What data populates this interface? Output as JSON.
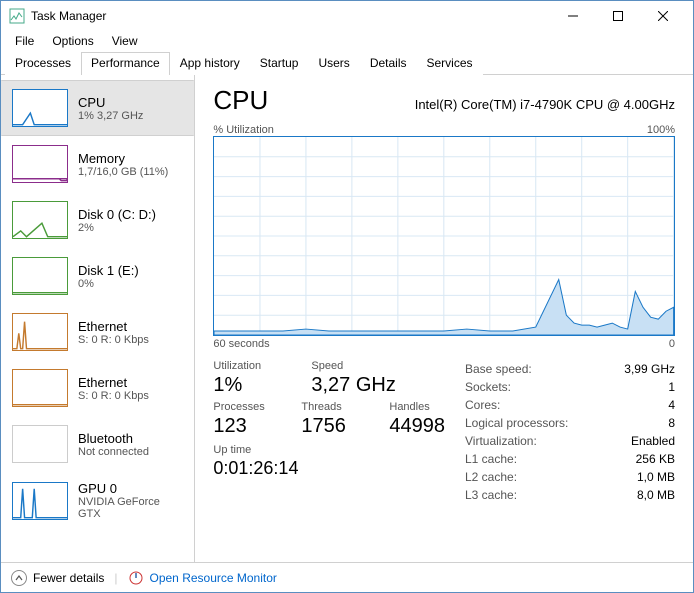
{
  "window": {
    "title": "Task Manager"
  },
  "menu": {
    "file": "File",
    "options": "Options",
    "view": "View"
  },
  "tabs": {
    "processes": "Processes",
    "performance": "Performance",
    "app_history": "App history",
    "startup": "Startup",
    "users": "Users",
    "details": "Details",
    "services": "Services"
  },
  "sidebar": [
    {
      "name": "CPU",
      "sub": "1% 3,27 GHz",
      "color": "#1a78c7"
    },
    {
      "name": "Memory",
      "sub": "1,7/16,0 GB (11%)",
      "color": "#8b2d8b"
    },
    {
      "name": "Disk 0 (C: D:)",
      "sub": "2%",
      "color": "#4a9b3a"
    },
    {
      "name": "Disk 1 (E:)",
      "sub": "0%",
      "color": "#4a9b3a"
    },
    {
      "name": "Ethernet",
      "sub": "S: 0  R: 0 Kbps",
      "color": "#c47a2e"
    },
    {
      "name": "Ethernet",
      "sub": "S: 0  R: 0 Kbps",
      "color": "#c47a2e"
    },
    {
      "name": "Bluetooth",
      "sub": "Not connected",
      "color": "#aaa"
    },
    {
      "name": "GPU 0",
      "sub": "NVIDIA GeForce GTX",
      "color": "#1a78c7"
    }
  ],
  "detail": {
    "title": "CPU",
    "model": "Intel(R) Core(TM) i7-4790K CPU @ 4.00GHz",
    "chart_top_left": "% Utilization",
    "chart_top_right": "100%",
    "chart_bottom_left": "60 seconds",
    "chart_bottom_right": "0",
    "util_label": "Utilization",
    "util": "1%",
    "speed_label": "Speed",
    "speed": "3,27 GHz",
    "proc_label": "Processes",
    "proc": "123",
    "thread_label": "Threads",
    "thread": "1756",
    "handle_label": "Handles",
    "handle": "44998",
    "uptime_label": "Up time",
    "uptime": "0:01:26:14",
    "right": [
      {
        "k": "Base speed:",
        "v": "3,99 GHz"
      },
      {
        "k": "Sockets:",
        "v": "1"
      },
      {
        "k": "Cores:",
        "v": "4"
      },
      {
        "k": "Logical processors:",
        "v": "8"
      },
      {
        "k": "Virtualization:",
        "v": "Enabled"
      },
      {
        "k": "L1 cache:",
        "v": "256 KB"
      },
      {
        "k": "L2 cache:",
        "v": "1,0 MB"
      },
      {
        "k": "L3 cache:",
        "v": "8,0 MB"
      }
    ]
  },
  "footer": {
    "fewer": "Fewer details",
    "rm": "Open Resource Monitor"
  },
  "chart_data": {
    "type": "line",
    "title": "% Utilization",
    "xlabel": "60 seconds",
    "ylabel": "",
    "xlim": [
      60,
      0
    ],
    "ylim": [
      0,
      100
    ],
    "x": [
      60,
      57,
      54,
      51,
      48,
      45,
      42,
      39,
      36,
      33,
      30,
      27,
      24,
      21,
      18,
      15,
      14,
      13,
      12,
      11,
      10,
      9,
      8,
      7,
      6,
      5,
      4,
      3,
      2,
      1,
      0
    ],
    "values": [
      2,
      2,
      2,
      2,
      3,
      2,
      2,
      2,
      2,
      2,
      2,
      3,
      2,
      2,
      4,
      28,
      10,
      6,
      5,
      5,
      4,
      5,
      6,
      4,
      3,
      22,
      14,
      9,
      8,
      12,
      14
    ]
  }
}
